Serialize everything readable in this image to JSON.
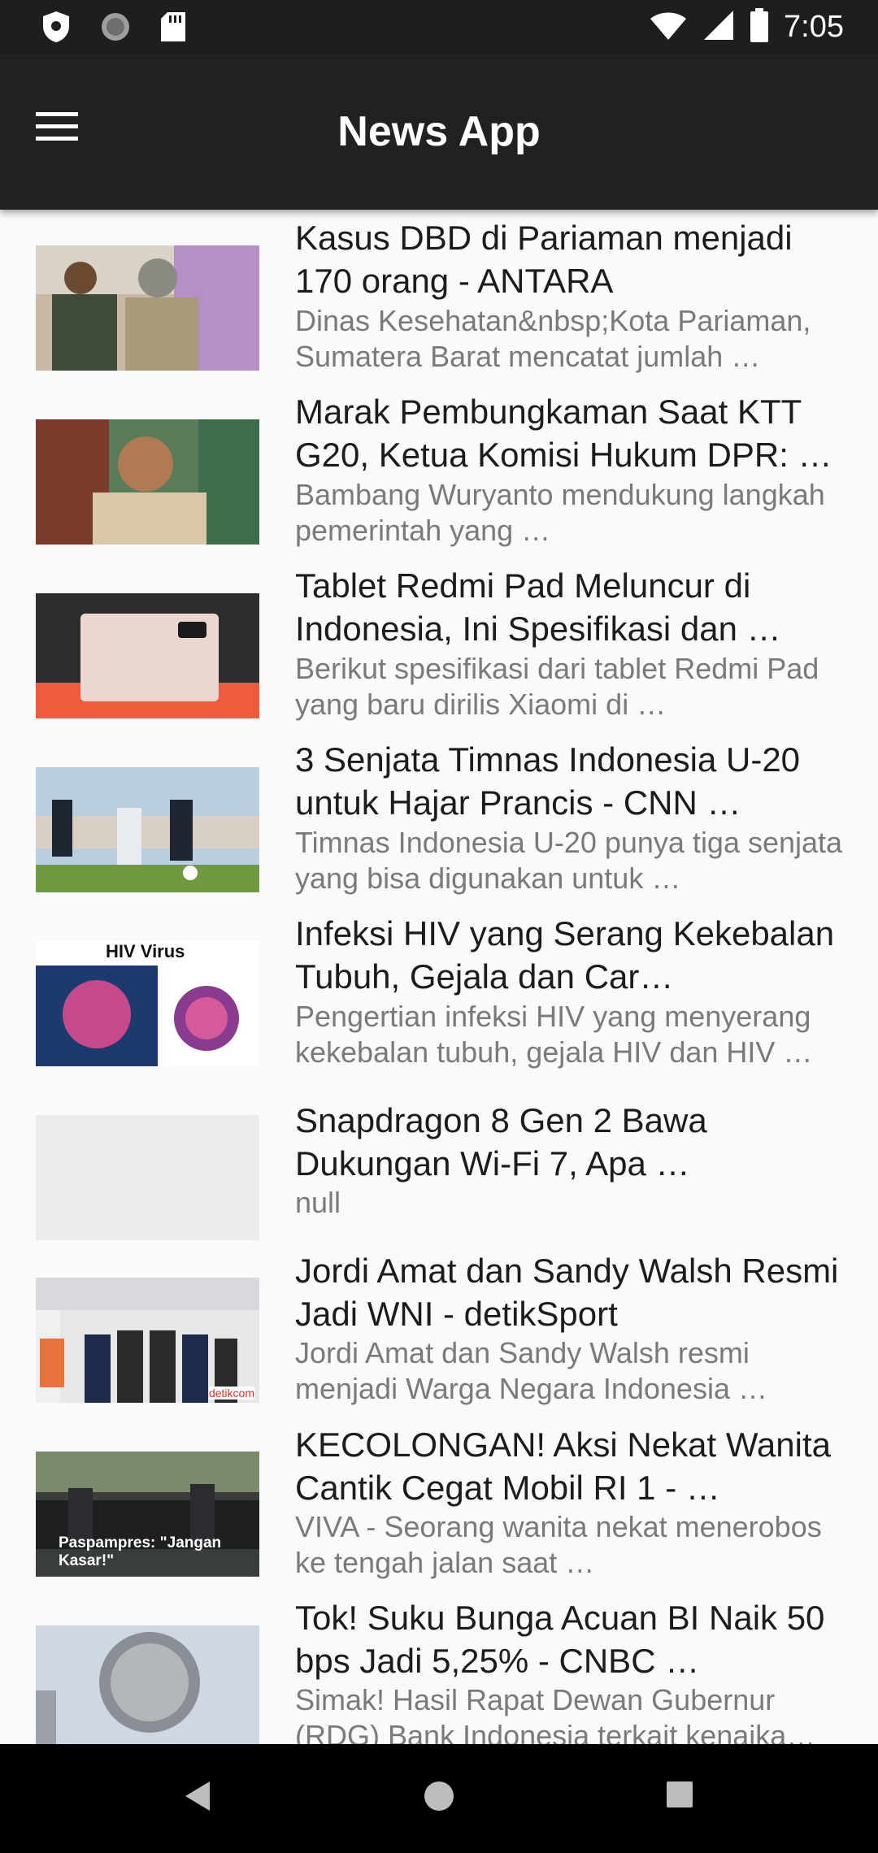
{
  "status_bar": {
    "time": "7:05",
    "left_icons": [
      "shield-icon",
      "sync-icon",
      "sd-card-icon"
    ],
    "right_icons": [
      "wifi-icon",
      "signal-icon",
      "battery-icon"
    ]
  },
  "app_bar": {
    "title": "News App",
    "menu_icon": "hamburger-menu-icon"
  },
  "news": [
    {
      "title": "Kasus DBD di Pariaman menjadi 170 orang - ANTARA",
      "description": "Dinas Kesehatan&nbsp;Kota Pariaman, Sumatera Barat mencatat jumlah …",
      "image": "photo"
    },
    {
      "title": "Marak Pembungkaman Saat KTT G20, Ketua Komisi Hukum DPR: …",
      "description": "Bambang Wuryanto mendukung langkah pemerintah yang …",
      "image": "photo"
    },
    {
      "title": "Tablet Redmi Pad Meluncur di Indonesia, Ini Spesifikasi dan …",
      "description": "Berikut spesifikasi dari tablet Redmi Pad yang baru dirilis Xiaomi di …",
      "image": "photo"
    },
    {
      "title": "3 Senjata Timnas Indonesia U-20 untuk Hajar Prancis - CNN …",
      "description": "Timnas Indonesia U-20 punya tiga senjata yang bisa digunakan untuk …",
      "image": "photo"
    },
    {
      "title": "Infeksi HIV yang Serang Kekebalan Tubuh, Gejala dan Car…",
      "description": "Pengertian infeksi HIV yang menyerang kekebalan tubuh, gejala HIV dan HIV …",
      "image": "photo",
      "image_text": "HIV Virus"
    },
    {
      "title": "Snapdragon 8 Gen 2 Bawa Dukungan Wi-Fi 7, Apa …",
      "description": "null",
      "image": "placeholder"
    },
    {
      "title": "Jordi Amat dan Sandy Walsh Resmi Jadi WNI - detikSport",
      "description": "Jordi Amat dan Sandy Walsh resmi menjadi Warga Negara Indonesia …",
      "image": "photo",
      "image_text": "detikcom"
    },
    {
      "title": "KECOLONGAN! Aksi Nekat Wanita Cantik Cegat Mobil RI 1 - …",
      "description": "VIVA - Seorang wanita nekat menerobos ke tengah jalan saat …",
      "image": "photo",
      "image_text": "Paspampres: \"Jangan Kasar!\""
    },
    {
      "title": "Tok! Suku Bunga Acuan BI Naik 50 bps Jadi 5,25% - CNBC …",
      "description": "Simak! Hasil Rapat Dewan Gubernur (RDG) Bank Indonesia terkait kenaika…",
      "image": "photo"
    }
  ],
  "nav_bar": {
    "icons": [
      "back-icon",
      "home-icon",
      "recents-icon"
    ]
  }
}
